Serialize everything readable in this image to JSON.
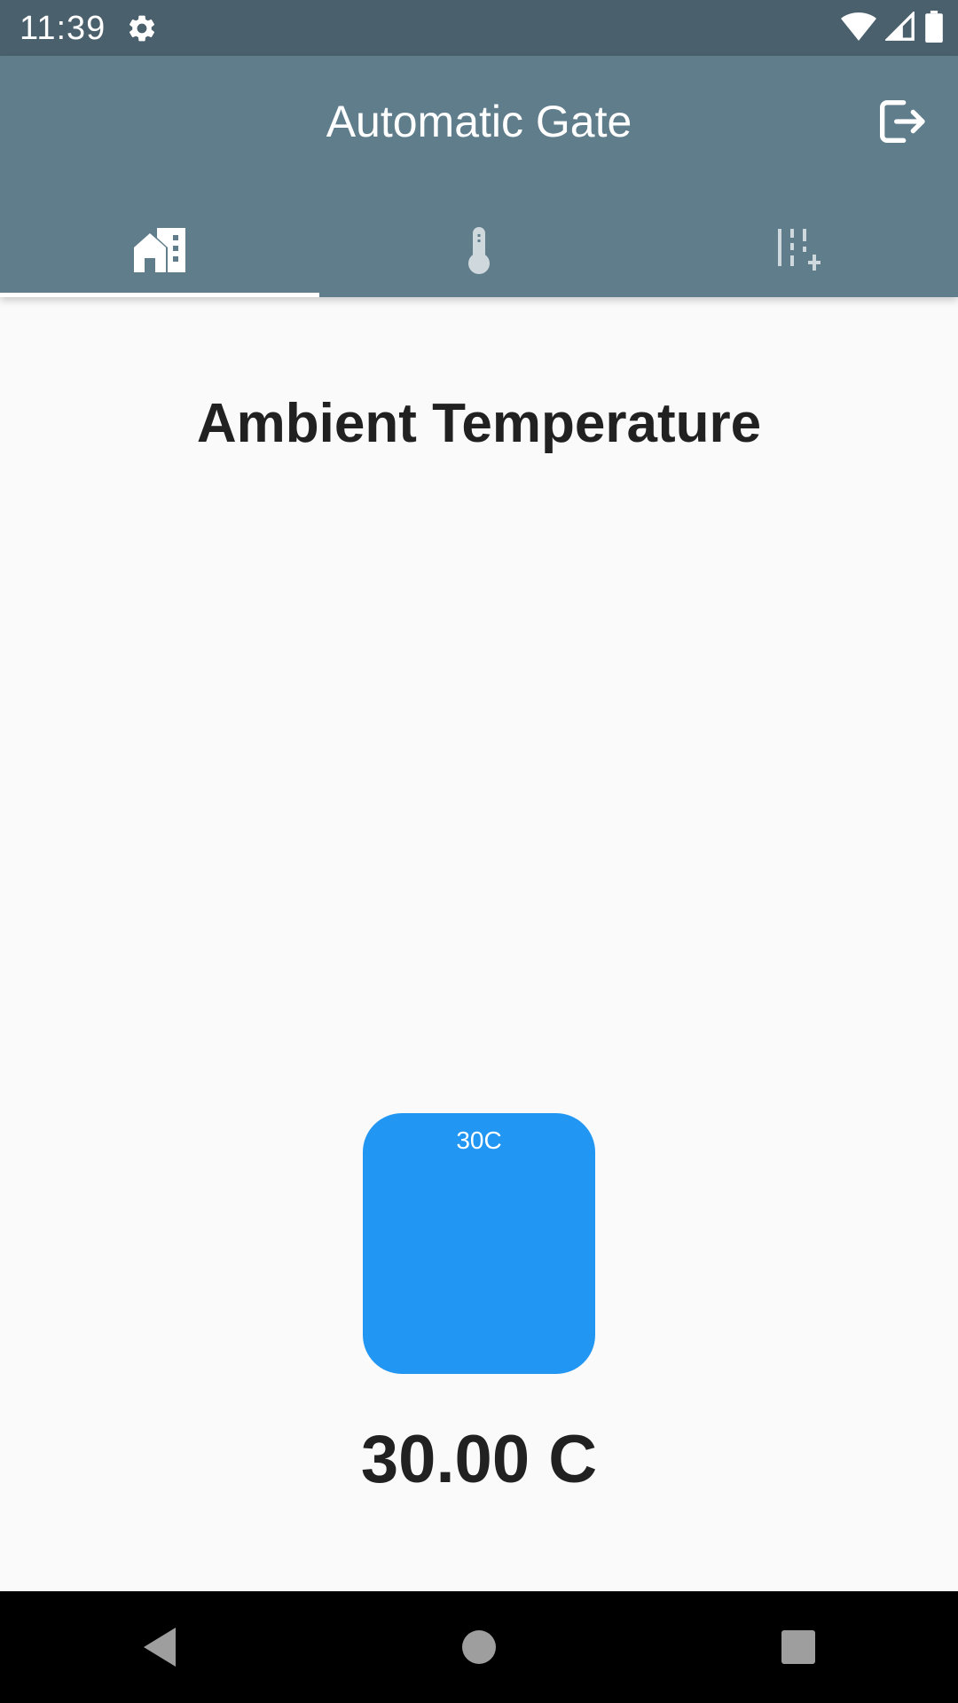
{
  "status_bar": {
    "time": "11:39",
    "icons": [
      "settings-icon",
      "wifi-icon",
      "signal-icon",
      "battery-icon"
    ]
  },
  "app_bar": {
    "title": "Automatic Gate",
    "action_icon": "logout-icon",
    "background_color": "#607d8b"
  },
  "tabs": {
    "items": [
      {
        "icon": "home-building-icon",
        "selected": true
      },
      {
        "icon": "thermometer-icon",
        "selected": false
      },
      {
        "icon": "sliders-add-icon",
        "selected": false
      }
    ]
  },
  "main": {
    "title": "Ambient Temperature",
    "gauge_label": "30C",
    "gauge_color": "#2196f3",
    "temperature_reading": "30.00 C"
  },
  "nav_bar": {
    "buttons": [
      "back-icon",
      "home-icon",
      "recents-icon"
    ]
  }
}
